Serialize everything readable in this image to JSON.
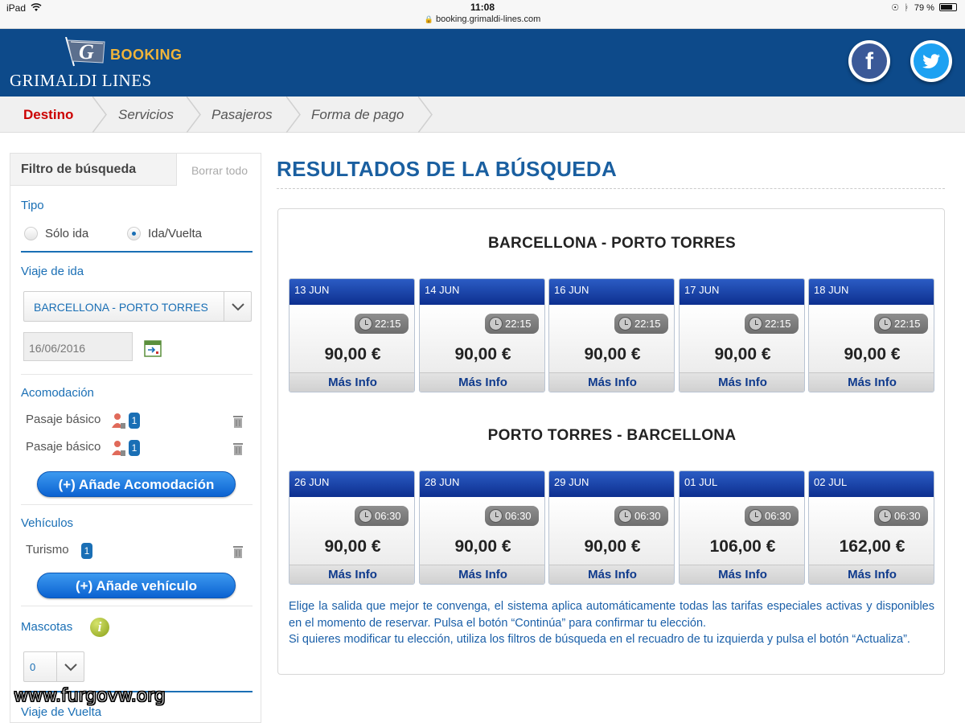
{
  "status_bar": {
    "device": "iPad",
    "time": "11:08",
    "url": "booking.grimaldi-lines.com",
    "battery": "79 %",
    "battery_level": 0.79
  },
  "header": {
    "brand": "GRIMALDI LINES",
    "booking_label": "BOOKING",
    "logo_letter": "G",
    "facebook_letter": "f"
  },
  "steps": [
    "Destino",
    "Servicios",
    "Pasajeros",
    "Forma de pago"
  ],
  "sidebar": {
    "title": "Filtro de búsqueda",
    "clear_label": "Borrar todo",
    "tipo": {
      "title": "Tipo",
      "option_one_way": "Sólo ida",
      "option_return": "Ida/Vuelta",
      "selected": "Ida/Vuelta"
    },
    "viaje_ida": {
      "title": "Viaje de ida",
      "route": "BARCELLONA - PORTO TORRES",
      "date": "16/06/2016"
    },
    "acomodacion": {
      "title": "Acomodación",
      "items": [
        {
          "label": "Pasaje básico",
          "count": "1"
        },
        {
          "label": "Pasaje básico",
          "count": "1"
        }
      ],
      "add_label": "(+) Añade Acomodación"
    },
    "vehiculos": {
      "title": "Vehículos",
      "items": [
        {
          "label": "Turismo",
          "count": "1"
        }
      ],
      "add_label": "(+) Añade vehículo"
    },
    "mascotas": {
      "title": "Mascotas",
      "value": "0",
      "info_letter": "i"
    },
    "viaje_vuelta": {
      "title": "Viaje de Vuelta"
    }
  },
  "results": {
    "title": "RESULTADOS DE LA BÚSQUEDA",
    "outbound": {
      "route": "BARCELLONA - PORTO TORRES",
      "cards": [
        {
          "date": "13 JUN",
          "time": "22:15",
          "price": "90,00 €",
          "more": "Más Info"
        },
        {
          "date": "14 JUN",
          "time": "22:15",
          "price": "90,00 €",
          "more": "Más Info"
        },
        {
          "date": "16 JUN",
          "time": "22:15",
          "price": "90,00 €",
          "more": "Más Info"
        },
        {
          "date": "17 JUN",
          "time": "22:15",
          "price": "90,00 €",
          "more": "Más Info"
        },
        {
          "date": "18 JUN",
          "time": "22:15",
          "price": "90,00 €",
          "more": "Más Info"
        }
      ]
    },
    "return": {
      "route": "PORTO TORRES - BARCELLONA",
      "cards": [
        {
          "date": "26 JUN",
          "time": "06:30",
          "price": "90,00 €",
          "more": "Más Info"
        },
        {
          "date": "28 JUN",
          "time": "06:30",
          "price": "90,00 €",
          "more": "Más Info"
        },
        {
          "date": "29 JUN",
          "time": "06:30",
          "price": "90,00 €",
          "more": "Más Info"
        },
        {
          "date": "01 JUL",
          "time": "06:30",
          "price": "106,00 €",
          "more": "Más Info"
        },
        {
          "date": "02 JUL",
          "time": "06:30",
          "price": "162,00 €",
          "more": "Más Info"
        }
      ]
    },
    "explain_1": "Elige la salida que mejor te convenga, el sistema aplica automáticamente todas las tarifas especiales activas y disponibles en el momento de reservar. Pulsa el botón “Continúa” para confirmar tu elección.",
    "explain_2": "Si quieres modificar tu elección, utiliza los filtros de búsqueda en el recuadro de tu izquierda y pulsa el botón “Actualiza”."
  },
  "watermark": "www.furgovw.org",
  "colors": {
    "header_blue": "#0d4a8a",
    "accent_red": "#cc0000",
    "link_blue": "#1a6fb5",
    "booking_gold": "#f0b43a"
  }
}
